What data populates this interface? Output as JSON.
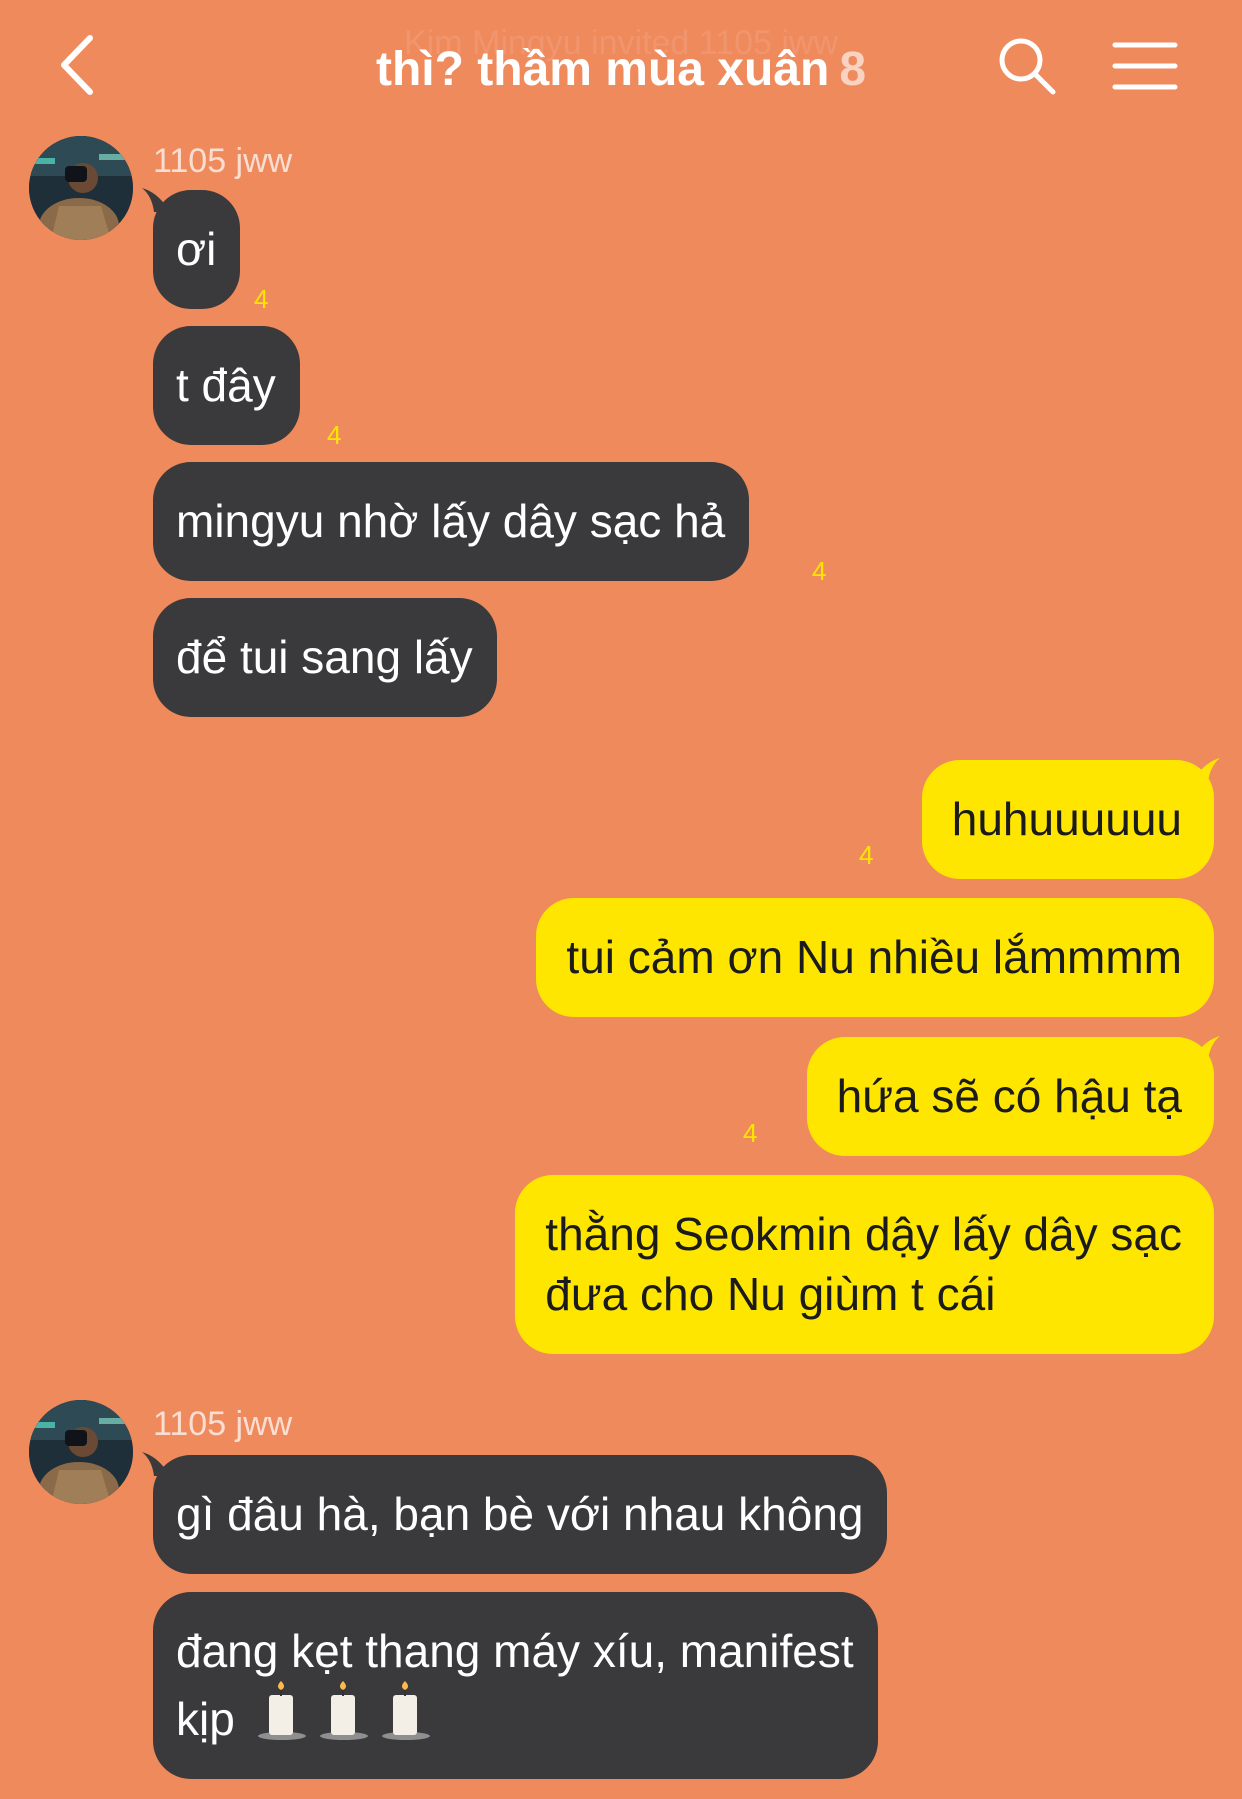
{
  "header": {
    "ghost_notice": "Kim Mingyu invited 1105 jww",
    "title": "thì? thầm mùa xuân",
    "member_count": "8"
  },
  "colors": {
    "background": "#EF8A5D",
    "incoming_bubble": "#3A3A3C",
    "outgoing_bubble": "#FFE600",
    "unread_count": "#FFE600"
  },
  "messages": {
    "group1": {
      "sender": "1105 jww",
      "m1": {
        "text": "ơi",
        "unread": "4"
      },
      "m2": {
        "text": "t đây",
        "unread": "4"
      },
      "m3": {
        "text": "mingyu nhờ lấy dây sạc hả",
        "unread": "4"
      },
      "m4": {
        "text": "để tui sang lấy"
      }
    },
    "group2": {
      "m1": {
        "text": "huhuuuuuu",
        "unread": "4"
      },
      "m2": {
        "text": "tui cảm ơn Nu nhiều lắmmmm"
      },
      "m3": {
        "text": "hứa sẽ có hậu tạ",
        "unread": "4"
      },
      "m4": {
        "line1": "thằng Seokmin dậy lấy dây sạc",
        "line2": "đưa cho Nu giùm t cái"
      }
    },
    "group3": {
      "sender": "1105 jww",
      "m1": {
        "text": "gì đâu hà, bạn bè với nhau không"
      },
      "m2": {
        "line1": "đang kẹt thang máy xíu, manifest",
        "line2": "kịp"
      }
    }
  },
  "icons": {
    "back": "chevron-left-icon",
    "search": "search-icon",
    "menu": "hamburger-menu-icon",
    "candle": "candle-emoji"
  }
}
